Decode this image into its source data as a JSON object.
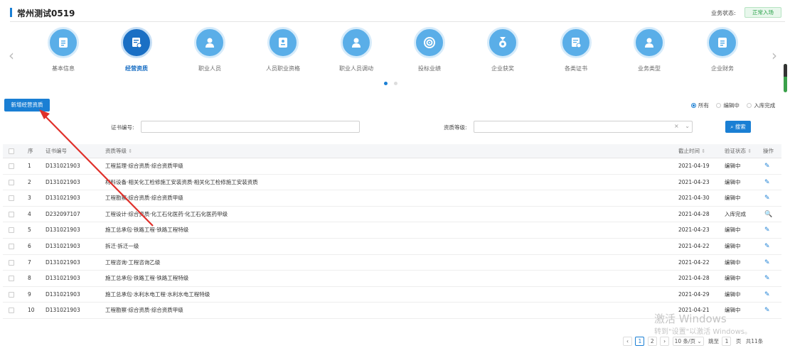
{
  "header": {
    "title": "常州测试0519",
    "status_label": "业务状态:",
    "status_value": "正常入场"
  },
  "carousel": {
    "items": [
      {
        "label": "基本信息",
        "icon": "document-list-icon"
      },
      {
        "label": "经营资质",
        "icon": "certificate-icon"
      },
      {
        "label": "职业人员",
        "icon": "person-icon"
      },
      {
        "label": "人员职业资格",
        "icon": "id-card-icon"
      },
      {
        "label": "职业人员调动",
        "icon": "person-transfer-icon"
      },
      {
        "label": "投标业绩",
        "icon": "target-icon"
      },
      {
        "label": "企业获奖",
        "icon": "medal-icon"
      },
      {
        "label": "各类证书",
        "icon": "certificate-icon"
      },
      {
        "label": "业务类型",
        "icon": "person-icon"
      },
      {
        "label": "企业财务",
        "icon": "document-list-icon"
      }
    ],
    "prev": "‹",
    "next": "›"
  },
  "toolbar": {
    "add_label": "新增经营资质",
    "radio_all": "所有",
    "radio_editing": "编辑中",
    "radio_done": "入库完成"
  },
  "filters": {
    "cert_label": "证书编号:",
    "cert_value": "",
    "grade_label": "资质等级:",
    "grade_value": "",
    "select_clear": "×",
    "select_arrow": "⌄",
    "search_label": "搜索"
  },
  "table": {
    "headers": {
      "no": "序",
      "cert": "证书编号",
      "grade": "资质等级",
      "date": "截止时间",
      "status": "验证状态",
      "op": "操作",
      "sort": "⇕"
    },
    "rows": [
      {
        "no": "1",
        "cert": "D131021903",
        "grade": "工程监理·综合资质·综合资质甲级",
        "date": "2021-04-19",
        "status": "编辑中",
        "op": "✎"
      },
      {
        "no": "2",
        "cert": "D131021903",
        "grade": "材料设备·相关化工检修施工安装资质·相关化工检修施工安装资质",
        "date": "2021-04-23",
        "status": "编辑中",
        "op": "✎"
      },
      {
        "no": "3",
        "cert": "D131021903",
        "grade": "工程勘察·综合资质·综合资质甲级",
        "date": "2021-04-30",
        "status": "编辑中",
        "op": "✎"
      },
      {
        "no": "4",
        "cert": "D232097107",
        "grade": "工程设计·综合资质·化工石化医药·化工石化医药甲级",
        "date": "2021-04-28",
        "status": "入库完成",
        "op": "🔍"
      },
      {
        "no": "5",
        "cert": "D131021903",
        "grade": "施工总承包·铁路工程·铁路工程特级",
        "date": "2021-04-23",
        "status": "编辑中",
        "op": "✎"
      },
      {
        "no": "6",
        "cert": "D131021903",
        "grade": "拆迁·拆迁一级",
        "date": "2021-04-22",
        "status": "编辑中",
        "op": "✎"
      },
      {
        "no": "7",
        "cert": "D131021903",
        "grade": "工程咨询·工程咨询乙级",
        "date": "2021-04-22",
        "status": "编辑中",
        "op": "✎"
      },
      {
        "no": "8",
        "cert": "D131021903",
        "grade": "施工总承包·铁路工程·铁路工程特级",
        "date": "2021-04-28",
        "status": "编辑中",
        "op": "✎"
      },
      {
        "no": "9",
        "cert": "D131021903",
        "grade": "施工总承包·水利水电工程·水利水电工程特级",
        "date": "2021-04-29",
        "status": "编辑中",
        "op": "✎"
      },
      {
        "no": "10",
        "cert": "D131021903",
        "grade": "工程勘察·综合资质·综合资质甲级",
        "date": "2021-04-21",
        "status": "编辑中",
        "op": "✎"
      }
    ]
  },
  "pagination": {
    "prev": "‹",
    "page1": "1",
    "page2": "2",
    "next": "›",
    "page_size": "10 条/页 ⌄",
    "goto_label": "跳至",
    "goto_value": "1",
    "page_unit": "页",
    "total": "共11条"
  },
  "watermark": {
    "line1": "激活 Windows",
    "line2": "转到\"设置\"以激活 Windows。"
  },
  "colors": {
    "primary": "#1a7fd4",
    "active_circle": "#1a6fc4",
    "circle": "#5aaee8",
    "annotation_arrow": "#e0302a"
  }
}
